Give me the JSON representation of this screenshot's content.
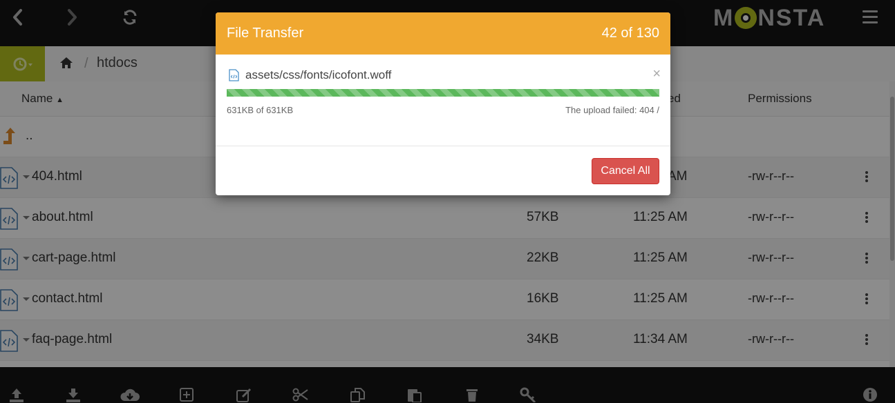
{
  "app": {
    "logo_text": "MONSTA",
    "colors": {
      "accent": "#b2c020",
      "modal_header": "#f0a830",
      "danger": "#d9534f",
      "progress": "#5cb85c"
    }
  },
  "toolbar": {
    "icons": [
      "back-icon",
      "forward-icon",
      "refresh-icon",
      "menu-icon"
    ]
  },
  "breadcrumb": {
    "home_icon": "home-icon",
    "separator": "/",
    "directory": "htdocs"
  },
  "file_list": {
    "columns": {
      "name": "Name",
      "name_sort": "▲",
      "modified_partial": "ed",
      "permissions": "Permissions"
    },
    "parent_label": "..",
    "rows": [
      {
        "name": "404.html",
        "size": "",
        "modified": "AM",
        "permissions": "-rw-r--r--"
      },
      {
        "name": "about.html",
        "size": "57KB",
        "modified": "11:25 AM",
        "permissions": "-rw-r--r--"
      },
      {
        "name": "cart-page.html",
        "size": "22KB",
        "modified": "11:25 AM",
        "permissions": "-rw-r--r--"
      },
      {
        "name": "contact.html",
        "size": "16KB",
        "modified": "11:25 AM",
        "permissions": "-rw-r--r--"
      },
      {
        "name": "faq-page.html",
        "size": "34KB",
        "modified": "11:34 AM",
        "permissions": "-rw-r--r--"
      }
    ]
  },
  "bottom_toolbar": {
    "icons": [
      "upload-icon",
      "download-icon",
      "cloud-download-icon",
      "new-folder-icon",
      "edit-icon",
      "cut-icon",
      "copy-icon",
      "paste-icon",
      "delete-icon",
      "key-icon",
      "info-icon"
    ]
  },
  "transfer_modal": {
    "title": "File Transfer",
    "count": "42 of 130",
    "path": "assets/css/fonts/icofont.woff",
    "close": "×",
    "progress_percent": 100,
    "bytes": "631KB of 631KB",
    "status": "The upload failed: 404 /",
    "cancel_label": "Cancel All"
  }
}
